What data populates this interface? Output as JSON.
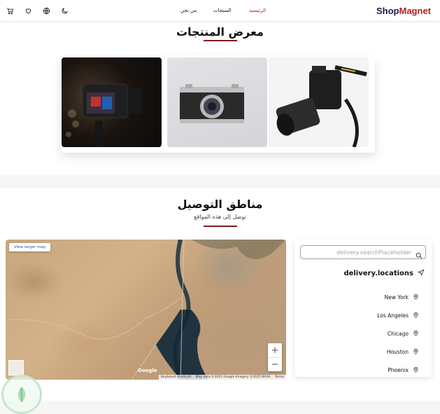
{
  "header": {
    "brand_part1": "Shop",
    "brand_part2": "Magnet",
    "nav": {
      "home": "الرئيسية",
      "products": "المنتجات",
      "about": "من نحن"
    },
    "icons": [
      "moon-icon",
      "globe-icon",
      "heart-icon",
      "cart-icon"
    ]
  },
  "gallery": {
    "title": "معرض المنتجات",
    "images": [
      "camera-photo-dark",
      "camera-photo-vintage",
      "camera-photo-dslr"
    ]
  },
  "delivery": {
    "title": "مناطق التوصيل",
    "subtitle": "توصل إلى هذه المواقع",
    "map": {
      "view_larger": "View larger map",
      "zoom_in": "+",
      "zoom_out": "−",
      "google": "Google",
      "shortcuts": "Keyboard shortcuts",
      "map_data": "Map data ©2025 Google Imagery ©2025 NASA",
      "terms": "Terms"
    },
    "panel": {
      "search_placeholder": "delivery.searchPlaceholder",
      "heading": "delivery.locations",
      "locations": [
        "New York",
        "Los Angeles",
        "Chicago",
        "Houston",
        "Phoenix"
      ]
    }
  },
  "colors": {
    "accent": "#b91c1c",
    "brand_dark": "#1e1b4b",
    "title_bar": "#7f1d1d"
  }
}
